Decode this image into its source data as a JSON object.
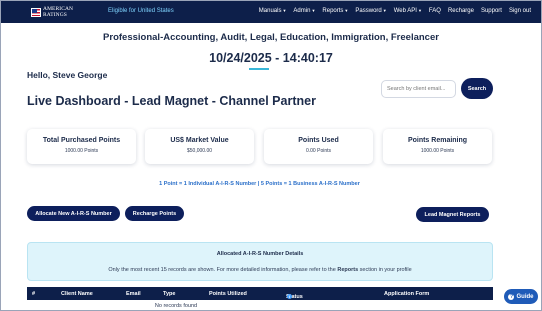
{
  "nav": {
    "logo_line1": "AMERICAN",
    "logo_line2": "RATINGS",
    "eligibility": "Eligible for United States",
    "items": [
      {
        "label": "Manuals",
        "dropdown": true
      },
      {
        "label": "Admin",
        "dropdown": true
      },
      {
        "label": "Reports",
        "dropdown": true
      },
      {
        "label": "Password",
        "dropdown": true
      },
      {
        "label": "Web API",
        "dropdown": true
      },
      {
        "label": "FAQ",
        "dropdown": false
      },
      {
        "label": "Recharge",
        "dropdown": false
      },
      {
        "label": "Support",
        "dropdown": false
      },
      {
        "label": "Sign out",
        "dropdown": false
      }
    ]
  },
  "header": {
    "professions": "Professional-Accounting, Audit, Legal, Education, Immigration, Freelancer",
    "datetime": "10/24/2025 - 14:40:17",
    "greeting": "Hello, Steve George",
    "title": "Live Dashboard - Lead Magnet - Channel Partner"
  },
  "search": {
    "placeholder": "Search by client email...",
    "button": "Search"
  },
  "cards": [
    {
      "title": "Total Purchased Points",
      "value": "1000.00 Points"
    },
    {
      "title": "US$ Market Value",
      "value": "$50,000.00"
    },
    {
      "title": "Points Used",
      "value": "0.00 Points"
    },
    {
      "title": "Points Remaining",
      "value": "1000.00 Points"
    }
  ],
  "points_info": "1 Point = 1 Individual A-I-R-S Number | 5 Points = 1 Business A-I-R-S Number",
  "actions": {
    "allocate": "Allocate New A-I-R-S Number",
    "recharge": "Recharge Points",
    "reports": "Lead Magnet Reports"
  },
  "allocated": {
    "title": "Allocated A-I-R-S Number Details",
    "note_prefix": "Only the most recent 15 records are shown. For more detailed information, please refer to the",
    "note_link": "Reports",
    "note_suffix": "section in your profile"
  },
  "table": {
    "columns": [
      "#",
      "Client Name",
      "Email",
      "Type",
      "Points Utilized",
      "Status",
      "Application Form"
    ],
    "empty_message": "No records found"
  },
  "guide_label": "Guide",
  "colors": {
    "navy": "#0d1f4a",
    "button_navy": "#0d1f5c",
    "accent_cyan": "#38b6d8",
    "info_blue": "#2a6fc9",
    "panel_bg": "#def4fb",
    "guide_blue": "#1f5bb8"
  }
}
